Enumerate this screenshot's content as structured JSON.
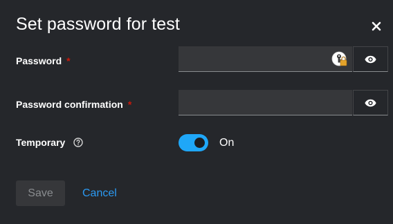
{
  "modal": {
    "title": "Set password for test",
    "close_icon": "close-icon"
  },
  "fields": {
    "password": {
      "label": "Password",
      "required_marker": "*",
      "value": "",
      "toggle_icon": "eye-icon",
      "manager_icon": "password-manager-icon"
    },
    "password_confirmation": {
      "label": "Password confirmation",
      "required_marker": "*",
      "value": "",
      "toggle_icon": "eye-icon"
    },
    "temporary": {
      "label": "Temporary",
      "help_icon": "help-icon",
      "state": true,
      "state_label": "On"
    }
  },
  "actions": {
    "save_label": "Save",
    "cancel_label": "Cancel"
  },
  "colors": {
    "background": "#25272b",
    "input_background": "#36373a",
    "required": "#c9190b",
    "switch_on": "#1fa7f8",
    "link": "#2b9af3",
    "disabled_text": "#8a8d90"
  }
}
